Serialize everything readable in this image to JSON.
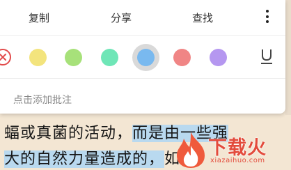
{
  "toolbar": {
    "copy_label": "复制",
    "share_label": "分享",
    "find_label": "查找",
    "more_icon": "more-vertical-icon"
  },
  "highlight_colors": [
    {
      "name": "yellow",
      "hex": "#f3e47d"
    },
    {
      "name": "green",
      "hex": "#a7e17a"
    },
    {
      "name": "teal",
      "hex": "#6fe6b7"
    },
    {
      "name": "blue",
      "hex": "#79b9ef",
      "selected": true
    },
    {
      "name": "red",
      "hex": "#f08585"
    },
    {
      "name": "purple",
      "hex": "#b597f0"
    }
  ],
  "note": {
    "placeholder": "点击添加批注"
  },
  "book": {
    "line1_plain": "蝠或真菌的活动，",
    "line1_highlight": "而是由一些强",
    "line2_highlight": "大的自然力量造成的，",
    "line2_plain": "如"
  },
  "watermark": {
    "title": "下载火",
    "url": "xiazaihuo.com"
  }
}
